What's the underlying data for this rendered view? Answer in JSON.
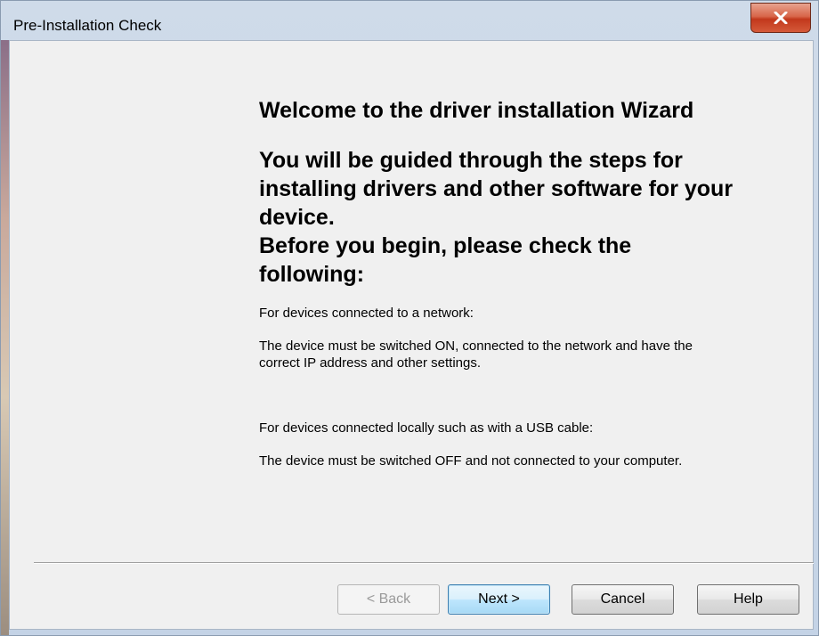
{
  "window": {
    "title": "Pre-Installation Check",
    "close_icon": "close-icon"
  },
  "main": {
    "welcome": "Welcome to the driver installation Wizard",
    "guided_line1": "You will be guided through the steps for",
    "guided_line2": "installing drivers and other software for your",
    "guided_line3": "device.",
    "check_line1": "Before you begin, please check the",
    "check_line2": "following:",
    "network_heading": "For devices connected to a network:",
    "network_line1": "The device must be switched ON, connected to the network and have the",
    "network_line2": "correct IP address and other settings.",
    "usb_heading": "For devices connected locally such as with a USB cable:",
    "usb_text": "The device must be switched OFF and not connected to your computer."
  },
  "buttons": {
    "back": "< Back",
    "next": "Next >",
    "cancel": "Cancel",
    "help": "Help"
  },
  "colors": {
    "client_background": "#f0f0f0",
    "close_button": "#c2381c",
    "default_button_border": "#3c7fb1"
  }
}
